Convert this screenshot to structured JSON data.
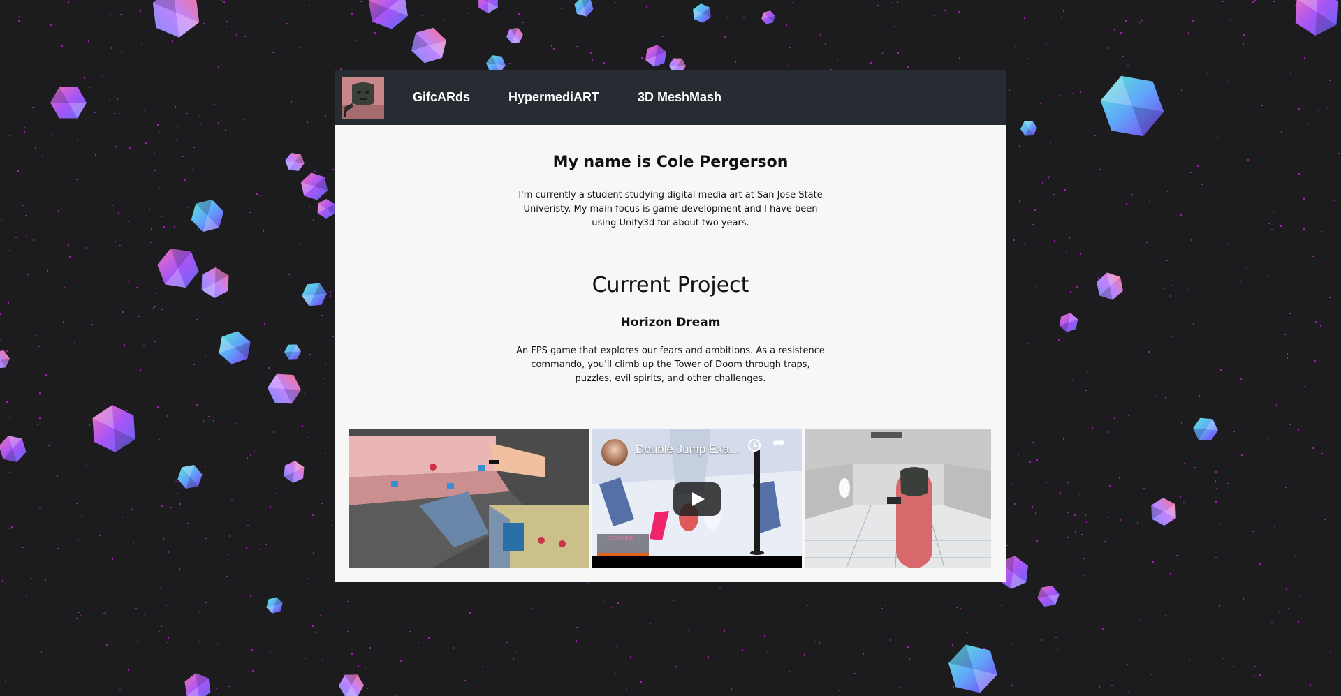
{
  "navbar": {
    "logo_icon": "pill-character-avatar-icon",
    "links": [
      {
        "label": "GifcARds"
      },
      {
        "label": "HypermediART"
      },
      {
        "label": "3D MeshMash"
      }
    ],
    "background": "#272c33"
  },
  "intro": {
    "heading": "My name is Cole Pergerson",
    "body": "I'm currently a student studying digital media art at San Jose State Univeristy. My main focus is game development and I have been using Unity3d for about two years."
  },
  "project": {
    "heading": "Current Project",
    "name": "Horizon Dream",
    "body": "An FPS game that explores our fears and ambitions. As a resistence commando, you'll climb up the Tower of Doom through traps, puzzles, evil spirits, and other challenges."
  },
  "gallery": {
    "video": {
      "title": "Double Jump Exa...",
      "hud_text": "DREAMING"
    }
  },
  "colors": {
    "page_background": "#1c1b1e",
    "card_background": "#f7f7f7",
    "star_dots": "#c026d3",
    "crystal_gradient": [
      "#4ee0c8",
      "#5a6cf0",
      "#c04ef0",
      "#f06ab0"
    ]
  }
}
